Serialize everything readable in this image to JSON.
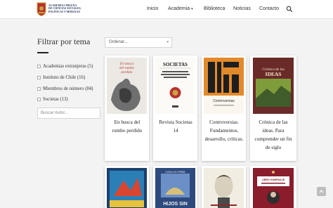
{
  "header": {
    "logo_lines": [
      "ACADEMIA CHILENA",
      "DE CIENCIAS SOCIALES,",
      "POLÍTICAS Y MORALES"
    ],
    "nav": [
      {
        "label": "Inicio",
        "has_dropdown": false
      },
      {
        "label": "Academia",
        "has_dropdown": true
      },
      {
        "label": "Biblioteca",
        "has_dropdown": false
      },
      {
        "label": "Noticias",
        "has_dropdown": false
      },
      {
        "label": "Contacto",
        "has_dropdown": false
      }
    ],
    "search_icon": "search-icon"
  },
  "sidebar": {
    "title": "Filtrar por tema",
    "filters": [
      {
        "label": "Academias extranjeras (5)"
      },
      {
        "label": "Instituto de Chile (16)"
      },
      {
        "label": "Miembros de número (84)"
      },
      {
        "label": "Societas (13)"
      }
    ],
    "author_search_placeholder": "Buscar Autor..."
  },
  "sort": {
    "placeholder": "Ordenar..."
  },
  "books": [
    {
      "title": "En busca del rumbo perdido",
      "cover_text": "En busca del rumbo perdido"
    },
    {
      "title": "Revista Societas 14",
      "cover_text": "SOCIETAS"
    },
    {
      "title": "Controversias. Fundamentos, desarrollo, críticas.",
      "cover_text": "Controversias"
    },
    {
      "title": "Crónica de las ideas. Para comprender un fin de siglo",
      "cover_text": "Crónica de las ideas"
    },
    {
      "title": "",
      "cover_text": ""
    },
    {
      "title": "",
      "cover_text": "HIJOS SIN PADRE"
    },
    {
      "title": "",
      "cover_text": ""
    },
    {
      "title": "",
      "cover_text": "LIBRO HOMENAJE"
    }
  ],
  "colors": {
    "accent": "#1d2b52",
    "background": "#f3f3f3"
  }
}
